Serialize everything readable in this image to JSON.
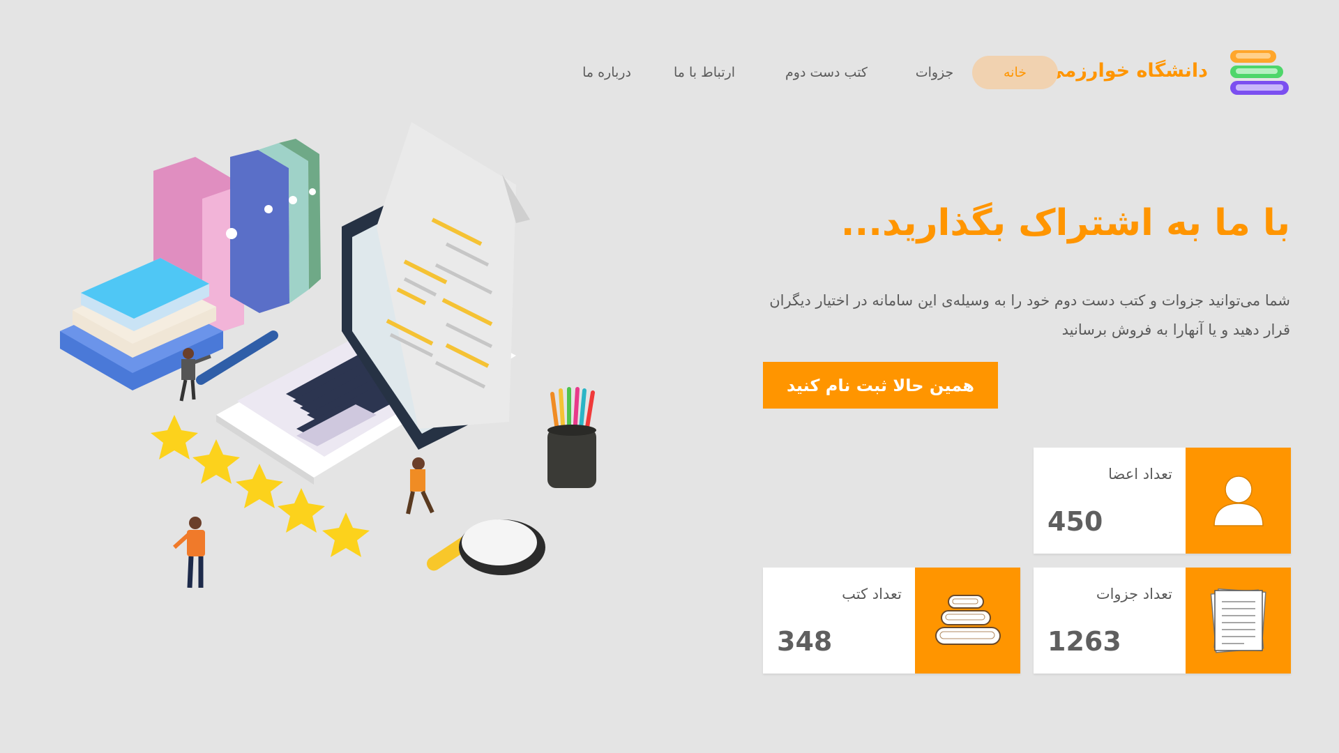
{
  "header": {
    "brand": "دانشگاه خوارزمی",
    "nav": [
      {
        "label": "خانه",
        "active": true
      },
      {
        "label": "جزوات",
        "active": false
      },
      {
        "label": "کتب دست دوم",
        "active": false
      },
      {
        "label": "ارتباط با ما",
        "active": false
      },
      {
        "label": "درباره ما",
        "active": false
      }
    ]
  },
  "hero": {
    "title": "با ما به اشتراک بگذارید...",
    "description": "شما می‌توانید جزوات و کتب دست دوم خود را به وسیله‌ی این سامانه در اختیار دیگران قرار دهید و یا آنها‌را به فروش برسانید",
    "cta": "همین حالا ثبت نام کنید"
  },
  "stats": {
    "members": {
      "label": "تعداد اعضا",
      "value": "450",
      "icon": "user-icon"
    },
    "notes": {
      "label": "تعداد جزوات",
      "value": "1263",
      "icon": "documents-icon"
    },
    "books": {
      "label": "تعداد کتب",
      "value": "348",
      "icon": "books-icon"
    }
  },
  "colors": {
    "accent": "#ff9500",
    "background": "#e4e4e4",
    "nav_active_bg": "#f1d2b0"
  }
}
